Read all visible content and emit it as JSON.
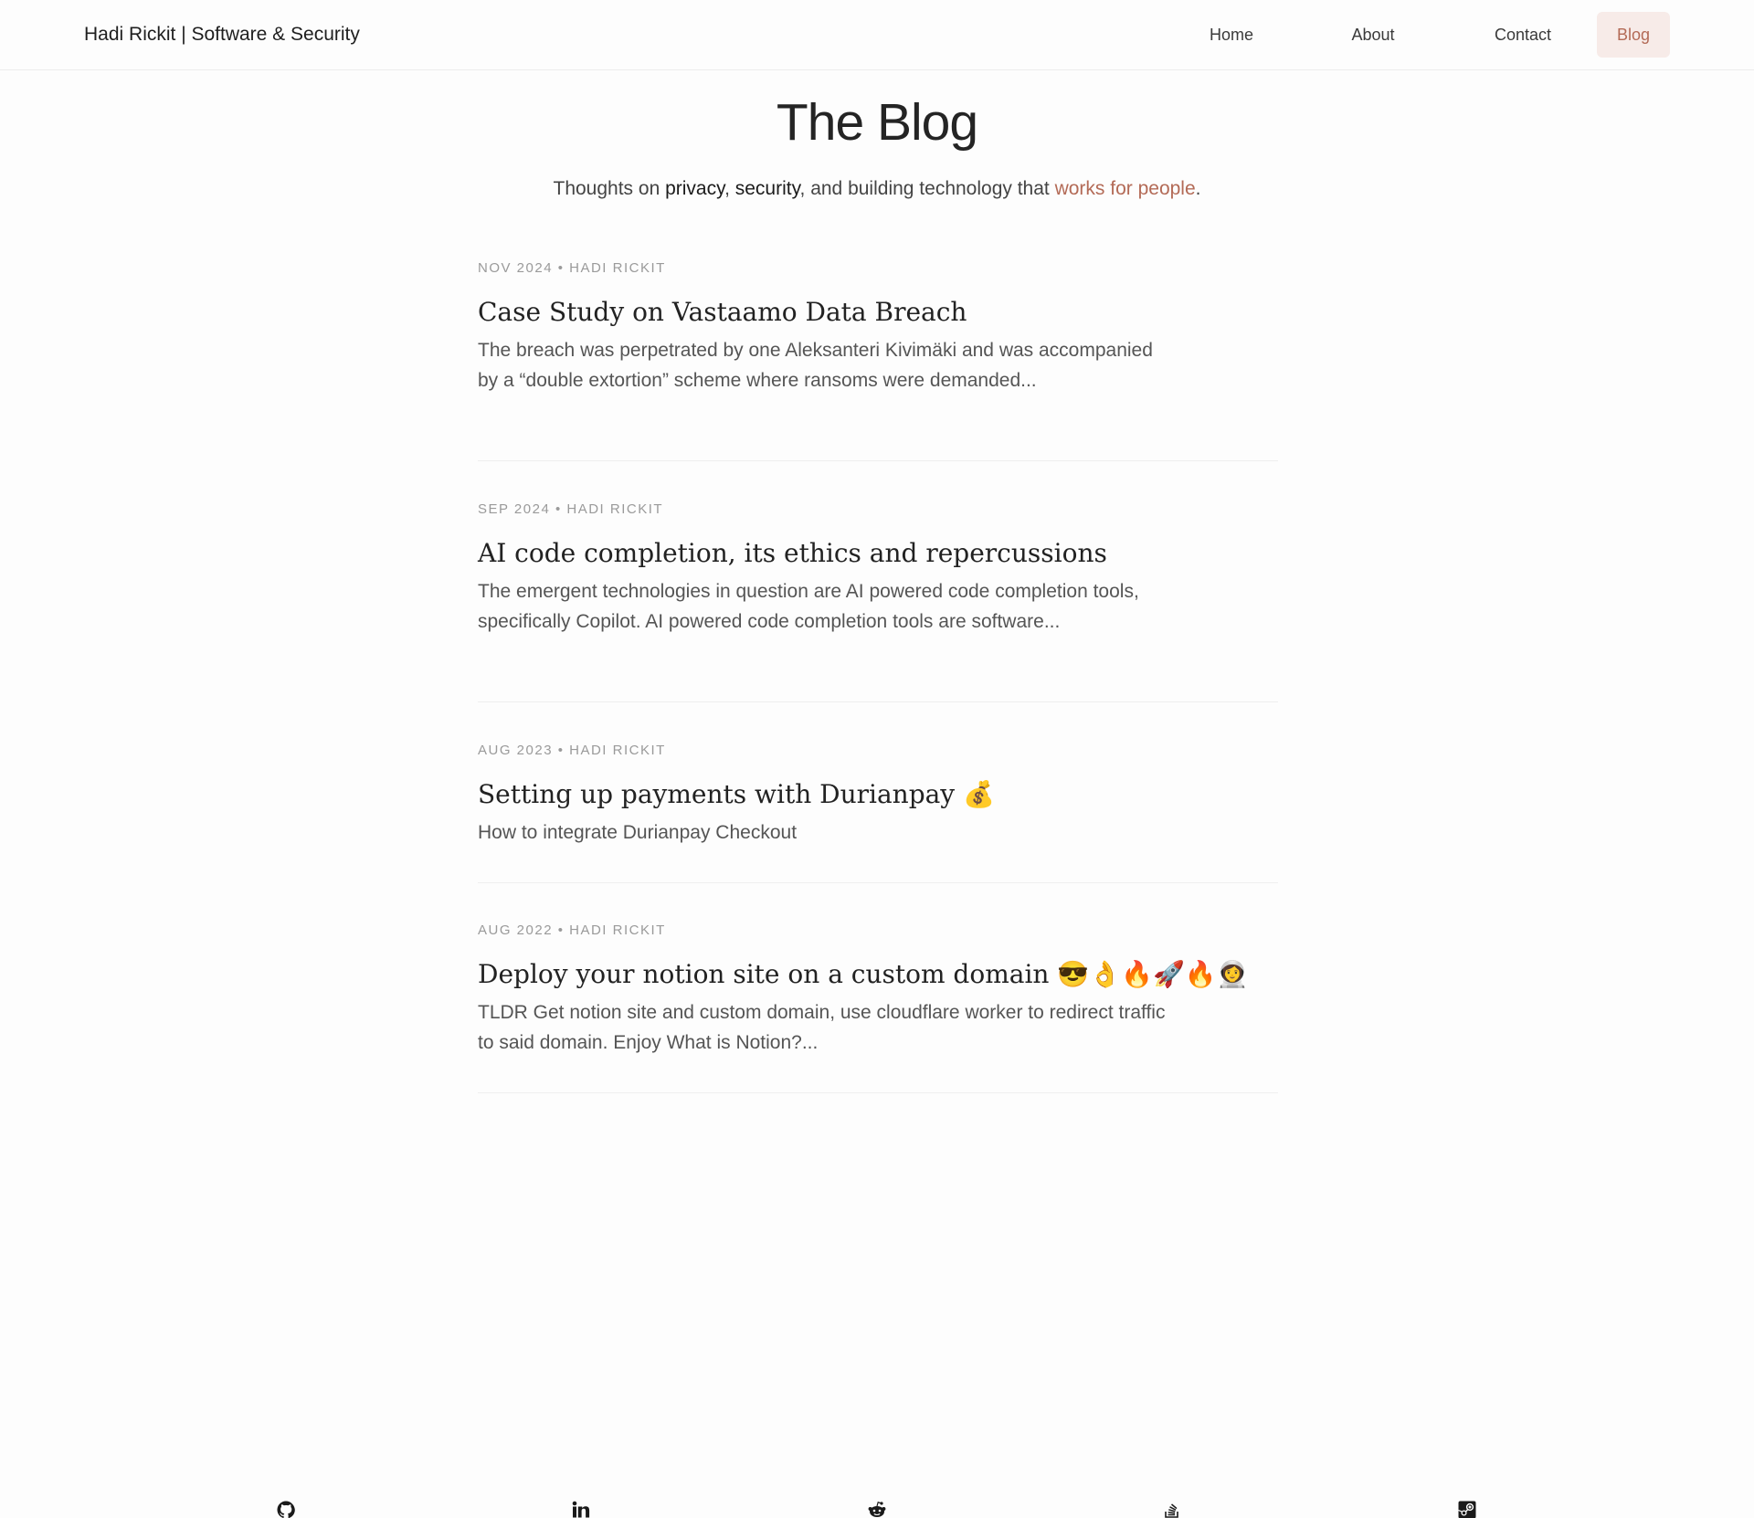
{
  "site": {
    "title": "Hadi Rickit | Software & Security"
  },
  "nav": {
    "items": [
      {
        "label": "Home"
      },
      {
        "label": "About"
      },
      {
        "label": "Contact"
      },
      {
        "label": "Blog",
        "active": true
      }
    ]
  },
  "hero": {
    "title": "The Blog",
    "subtitle": {
      "part1": "Thoughts on ",
      "privacy": "privacy",
      "part2": ", ",
      "security": "security",
      "part3": ", and building technology that ",
      "accent": "works for people",
      "part4": "."
    }
  },
  "posts": [
    {
      "meta": "NOV 2024 • HADI RICKIT",
      "title": "Case Study on Vastaamo Data Breach",
      "excerpt": "The breach was perpetrated by one Aleksanteri Kivimäki and was accompanied by a “double extortion” scheme where ransoms were demanded..."
    },
    {
      "meta": "SEP 2024 • HADI RICKIT",
      "title": "AI code completion, its ethics and repercussions",
      "excerpt": "The emergent technologies in question are AI powered code completion tools, specifically Copilot. AI powered code completion tools are software..."
    },
    {
      "meta": "AUG 2023 • HADI RICKIT",
      "title": "Setting up payments with Durianpay 💰",
      "excerpt": "How to integrate Durianpay Checkout"
    },
    {
      "meta": "AUG 2022 • HADI RICKIT",
      "title": "Deploy your notion site on a custom domain 😎👌🔥🚀🔥👩‍🚀",
      "excerpt": "TLDR Get notion site and custom domain, use cloudflare worker to redirect traffic to said domain. Enjoy What is Notion?..."
    }
  ],
  "footer": {
    "icons": [
      "github-icon",
      "linkedin-icon",
      "reddit-icon",
      "stackoverflow-icon",
      "steam-icon"
    ]
  },
  "colors": {
    "accent": "#b36a56",
    "accent_bg": "#f7ebe8",
    "background": "#fdfdfd"
  }
}
